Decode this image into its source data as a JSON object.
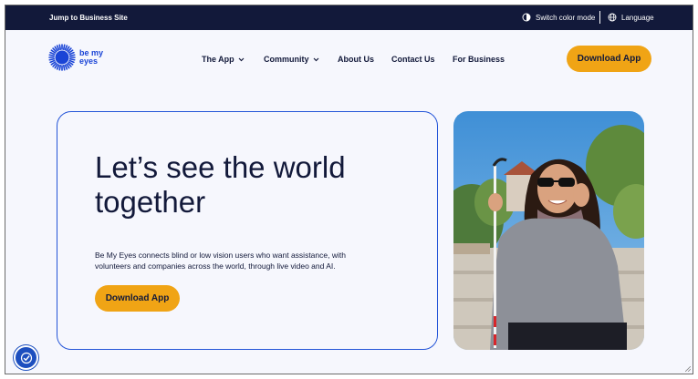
{
  "topbar": {
    "jump_link": "Jump to Business Site",
    "color_mode": "Switch color mode",
    "language": "Language"
  },
  "logo": {
    "line1": "be my",
    "line2": "eyes"
  },
  "nav": {
    "items": [
      {
        "label": "The App",
        "has_dropdown": true
      },
      {
        "label": "Community",
        "has_dropdown": true
      },
      {
        "label": "About Us",
        "has_dropdown": false
      },
      {
        "label": "Contact Us",
        "has_dropdown": false
      },
      {
        "label": "For Business",
        "has_dropdown": false
      }
    ],
    "download_button": "Download App"
  },
  "hero": {
    "title_line1": "Let’s see the world",
    "title_line2": "together",
    "description": "Be My Eyes connects blind or low vision users who want assistance, with volunteers and companies across the world, through live video and AI.",
    "download_button": "Download App"
  },
  "colors": {
    "topbar_bg": "#12193a",
    "accent_yellow": "#f0a415",
    "brand_blue": "#1a44d6",
    "text_dark": "#12193a",
    "card_border": "#2455d8"
  }
}
